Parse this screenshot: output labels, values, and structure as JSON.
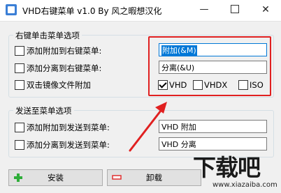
{
  "window": {
    "title": "VHD右键菜单 v1.0 By 风之暇想汉化",
    "minimize_glyph": "—",
    "close_glyph": "✕"
  },
  "context_menu_group": {
    "legend": "右键单击菜单选项",
    "add_attach": {
      "label": "添加附加到右键菜单:",
      "checked": false,
      "value": "附加(&M)"
    },
    "add_detach": {
      "label": "添加分离到右键菜单:",
      "checked": false,
      "value": "分离(&U)"
    },
    "double_click": {
      "label": "双击镜像文件附加",
      "checked": false
    },
    "formats": [
      {
        "label": "VHD",
        "checked": true
      },
      {
        "label": "VHDX",
        "checked": false
      },
      {
        "label": "ISO",
        "checked": false
      }
    ]
  },
  "sendto_group": {
    "legend": "发送至菜单选项",
    "add_attach": {
      "label": "添加附加到发送到菜单:",
      "checked": false,
      "value": "VHD 附加"
    },
    "add_detach": {
      "label": "添加分离到发送到菜单:",
      "checked": false,
      "value": "VHD 分离"
    }
  },
  "buttons": {
    "install_label": "安装",
    "uninstall_label": "卸载"
  },
  "watermark": {
    "brand": "下载吧",
    "url": "www.xiazaiba.com"
  },
  "colors": {
    "accent": "#0078d7",
    "annotation_red": "#e02020",
    "install_icon_green": "#2fae3a",
    "uninstall_icon_red": "#e03030"
  }
}
